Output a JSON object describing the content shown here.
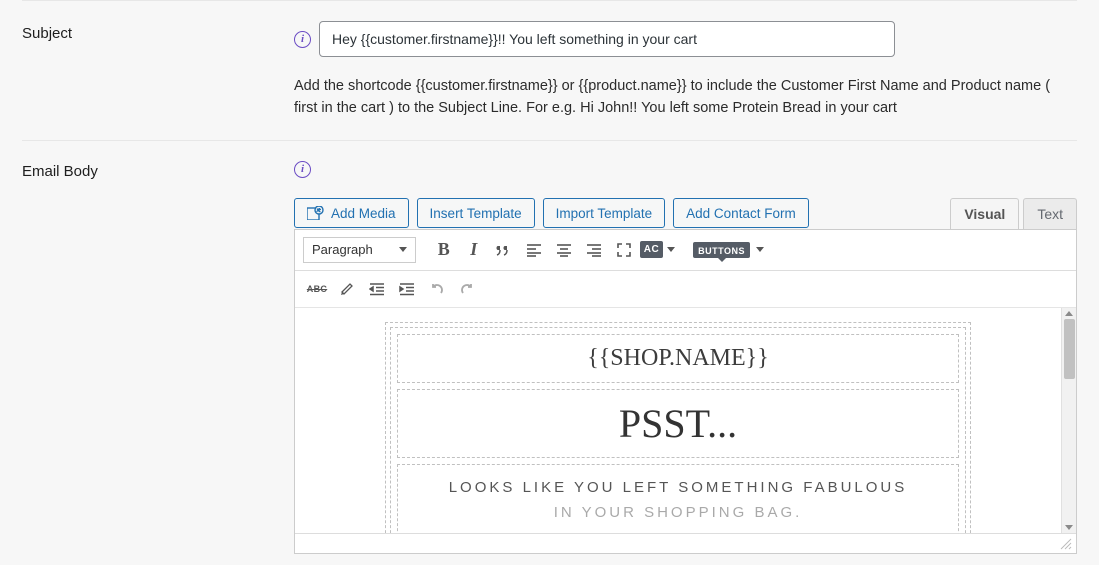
{
  "subject": {
    "label": "Subject",
    "value": "Hey {{customer.firstname}}!! You left something in your cart",
    "help": "Add the shortcode {{customer.firstname}} or {{product.name}} to include the Customer First Name and Product name ( first in the cart ) to the Subject Line. For e.g. Hi John!! You left some Protein Bread in your cart"
  },
  "body": {
    "label": "Email Body",
    "buttons": {
      "add_media": "Add Media",
      "insert_template": "Insert Template",
      "import_template": "Import Template",
      "add_contact_form": "Add Contact Form"
    },
    "tabs": {
      "visual": "Visual",
      "text": "Text"
    },
    "format_selector": "Paragraph",
    "ac_label": "AC",
    "buttons_dropdown_label": "BUTTONS",
    "abc_label": "ABC",
    "template": {
      "shop_name": "{{SHOP.NAME}}",
      "headline": "PSST...",
      "line1": "LOOKS LIKE YOU LEFT SOMETHING FABULOUS",
      "line2": "IN YOUR SHOPPING BAG."
    }
  }
}
